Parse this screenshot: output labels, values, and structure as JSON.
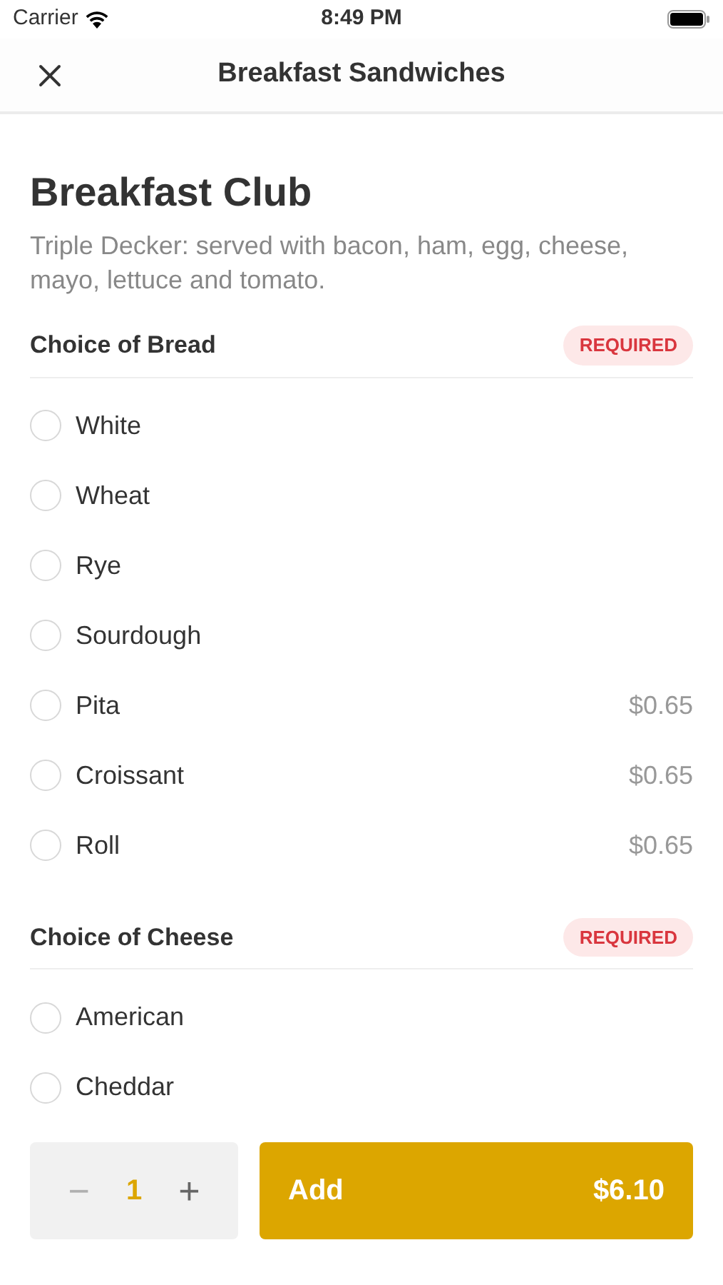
{
  "status_bar": {
    "carrier": "Carrier",
    "time": "8:49 PM"
  },
  "nav": {
    "title": "Breakfast Sandwiches"
  },
  "item": {
    "name": "Breakfast Club",
    "description": "Triple Decker: served with bacon, ham, egg, cheese, mayo, lettuce and tomato."
  },
  "sections": [
    {
      "title": "Choice of Bread",
      "badge": "REQUIRED",
      "options": [
        {
          "label": "White",
          "selected": false
        },
        {
          "label": "Wheat",
          "selected": false
        },
        {
          "label": "Rye",
          "selected": false
        },
        {
          "label": "Sourdough",
          "selected": false
        },
        {
          "label": "Pita",
          "price": "$0.65",
          "selected": false
        },
        {
          "label": "Croissant",
          "price": "$0.65",
          "selected": false
        },
        {
          "label": "Roll",
          "price": "$0.65",
          "selected": false
        }
      ]
    },
    {
      "title": "Choice of Cheese",
      "badge": "REQUIRED",
      "options": [
        {
          "label": "American",
          "selected": false
        },
        {
          "label": "Cheddar",
          "selected": false
        }
      ]
    }
  ],
  "footer": {
    "decrease": "−",
    "decrease_disabled": true,
    "quantity": "1",
    "increase": "+",
    "add_label": "Add",
    "total": "$6.10"
  }
}
